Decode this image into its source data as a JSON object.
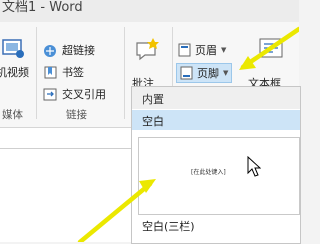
{
  "window": {
    "title": "文档1 - Word"
  },
  "ribbon": {
    "media_group": {
      "partial_label": "机视频",
      "group_label": "媒体"
    },
    "links_group": {
      "hyperlink": "超链接",
      "bookmark": "书签",
      "cross_reference": "交叉引用",
      "group_label": "链接"
    },
    "comment_group": {
      "comment": "批注"
    },
    "header_footer_group": {
      "header": "页眉",
      "footer": "页脚",
      "textbox_partial": "文本框"
    }
  },
  "footer_dropdown": {
    "section_heading": "内置",
    "items": [
      {
        "label": "空白",
        "preview_text": "[在此处键入]"
      },
      {
        "label": "空白(三栏)"
      }
    ]
  },
  "colors": {
    "arrow": "#ebe800",
    "selected": "#cde4f7",
    "accent_blue": "#2a6ebb"
  }
}
